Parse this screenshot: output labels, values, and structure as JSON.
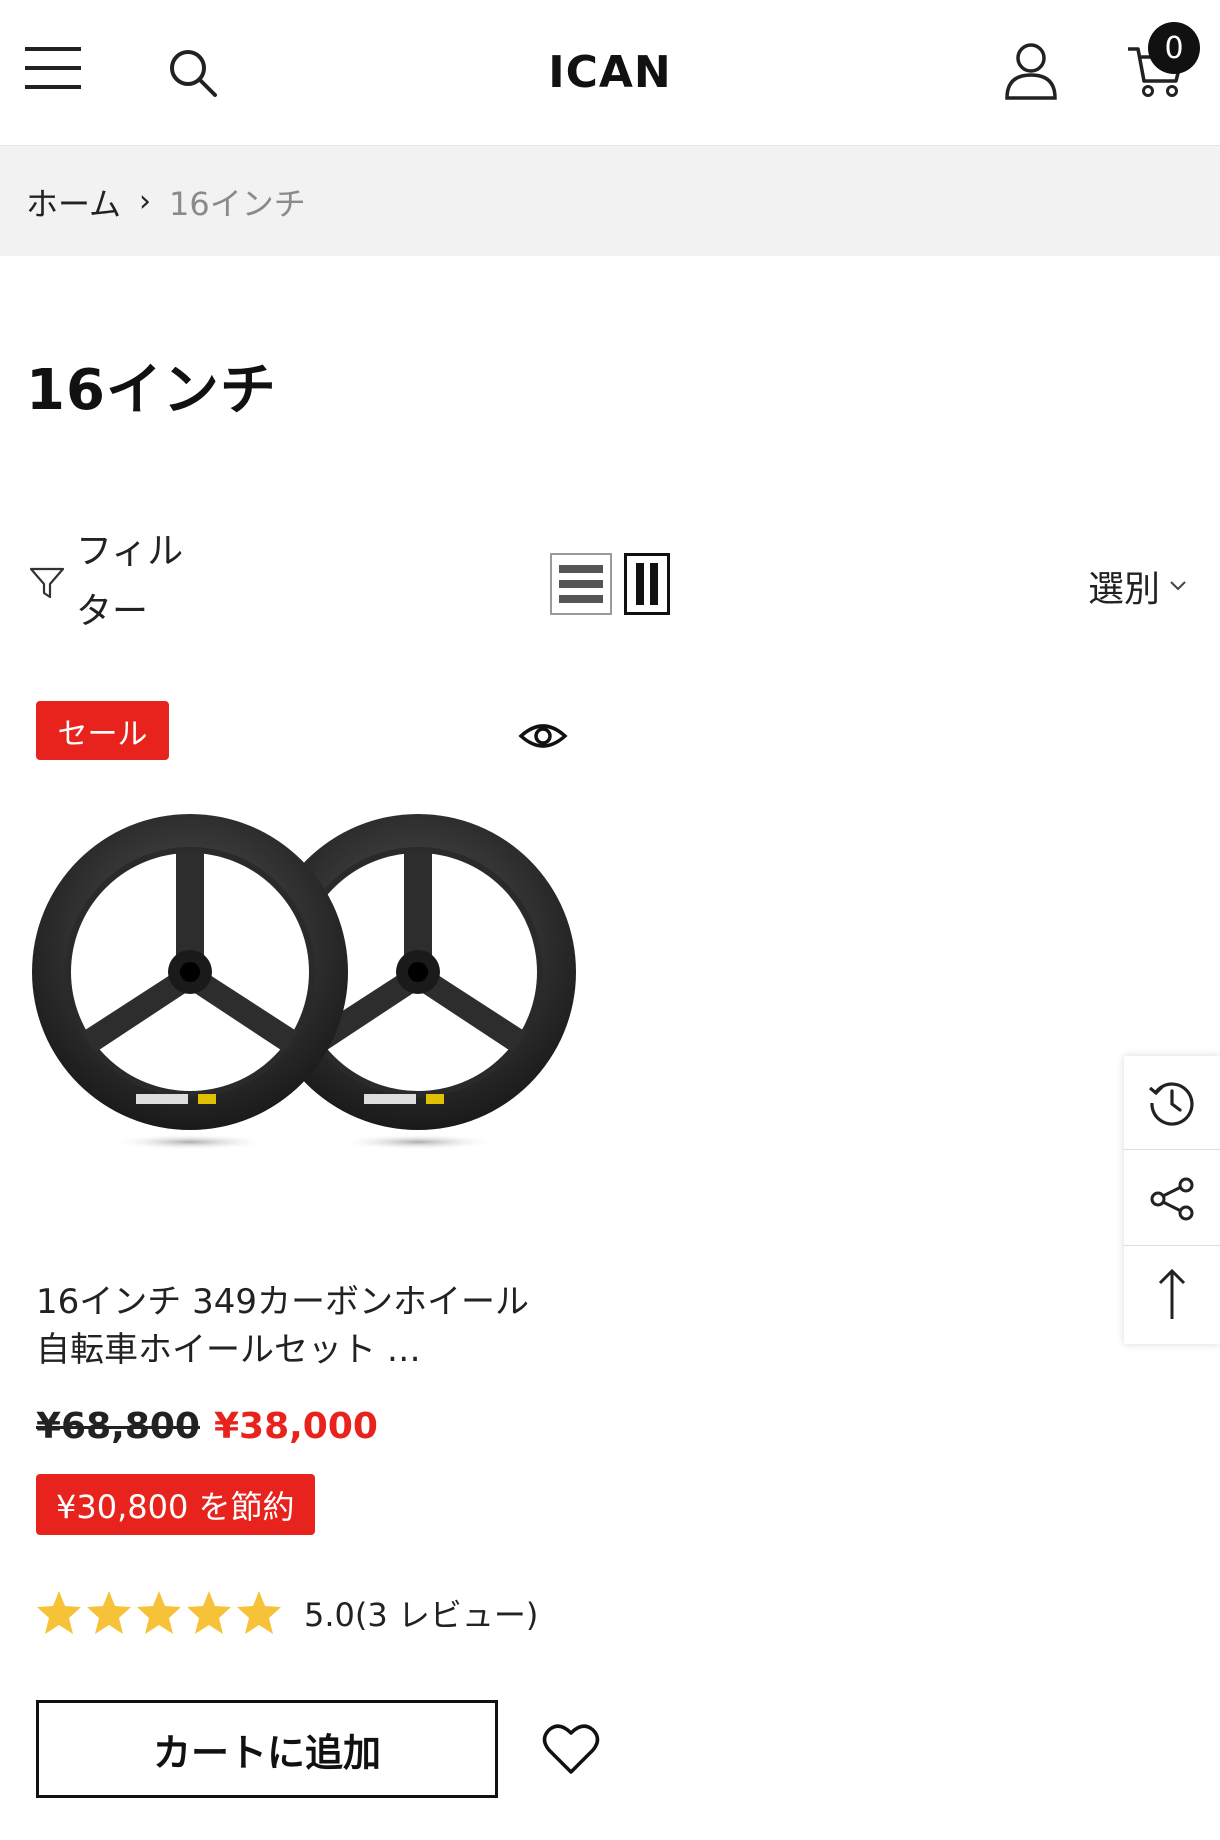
{
  "header": {
    "logo": "ICAN",
    "cart_count": "0"
  },
  "breadcrumb": {
    "home": "ホーム",
    "separator": "›",
    "current": "16インチ"
  },
  "page_title": "16インチ",
  "toolbar": {
    "filter_label": "フィルター",
    "sort_label": "選別"
  },
  "product": {
    "sale_badge": "セール",
    "title": "16インチ 349カーボンホイール　自転車ホイールセット …",
    "price_old": "¥68,800",
    "price_new": "¥38,000",
    "save_label": "¥30,800 を節約",
    "rating": 5.0,
    "rating_max": 5,
    "rating_text": "5.0(3 レビュー)",
    "add_to_cart": "カートに追加"
  },
  "colors": {
    "accent_red": "#e8231d",
    "star": "#f6c338",
    "text": "#222222"
  },
  "icons": {
    "menu": "hamburger-menu-icon",
    "search": "search-icon",
    "account": "user-icon",
    "cart": "cart-icon",
    "filter": "filter-icon",
    "view_list": "list-view-icon",
    "view_grid": "grid-view-icon",
    "quickview": "eye-icon",
    "wishlist": "heart-icon",
    "recent": "history-icon",
    "share": "share-icon",
    "top": "arrow-up-icon"
  }
}
